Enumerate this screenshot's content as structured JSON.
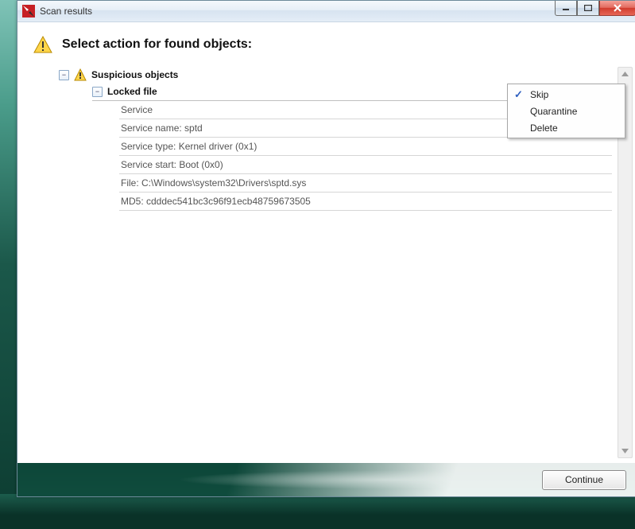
{
  "window": {
    "title": "Scan results"
  },
  "header": {
    "heading": "Select action for found objects:"
  },
  "tree": {
    "group": {
      "label": "Suspicious objects"
    },
    "item": {
      "label": "Locked file",
      "action_label": "Skip",
      "details": [
        "Service",
        "Service name: sptd",
        "Service type: Kernel driver (0x1)",
        "Service start: Boot (0x0)",
        "File: C:\\Windows\\system32\\Drivers\\sptd.sys",
        "MD5: cdddec541bc3c96f91ecb48759673505"
      ]
    }
  },
  "dropdown": {
    "items": [
      "Skip",
      "Quarantine",
      "Delete"
    ],
    "selected_index": 0
  },
  "footer": {
    "continue_label": "Continue"
  }
}
